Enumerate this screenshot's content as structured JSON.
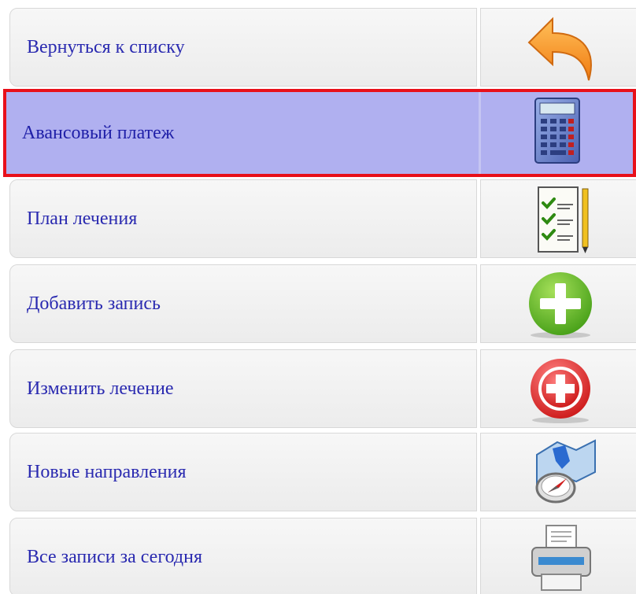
{
  "menu": {
    "items": [
      {
        "label": "Вернуться к списку",
        "icon": "back-arrow-icon",
        "active": false
      },
      {
        "label": "Авансовый платеж",
        "icon": "calculator-icon",
        "active": true
      },
      {
        "label": "План лечения",
        "icon": "checklist-icon",
        "active": false
      },
      {
        "label": "Добавить запись",
        "icon": "add-icon",
        "active": false
      },
      {
        "label": "Изменить лечение",
        "icon": "medical-cross-icon",
        "active": false
      },
      {
        "label": "Новые направления",
        "icon": "map-compass-icon",
        "active": false
      },
      {
        "label": "Все записи за сегодня",
        "icon": "printer-icon",
        "active": false
      }
    ]
  },
  "colors": {
    "label_text": "#2a2ab0",
    "active_background": "#b0b0f0",
    "active_border": "#e8101a",
    "row_background": "#f0f0f0"
  }
}
